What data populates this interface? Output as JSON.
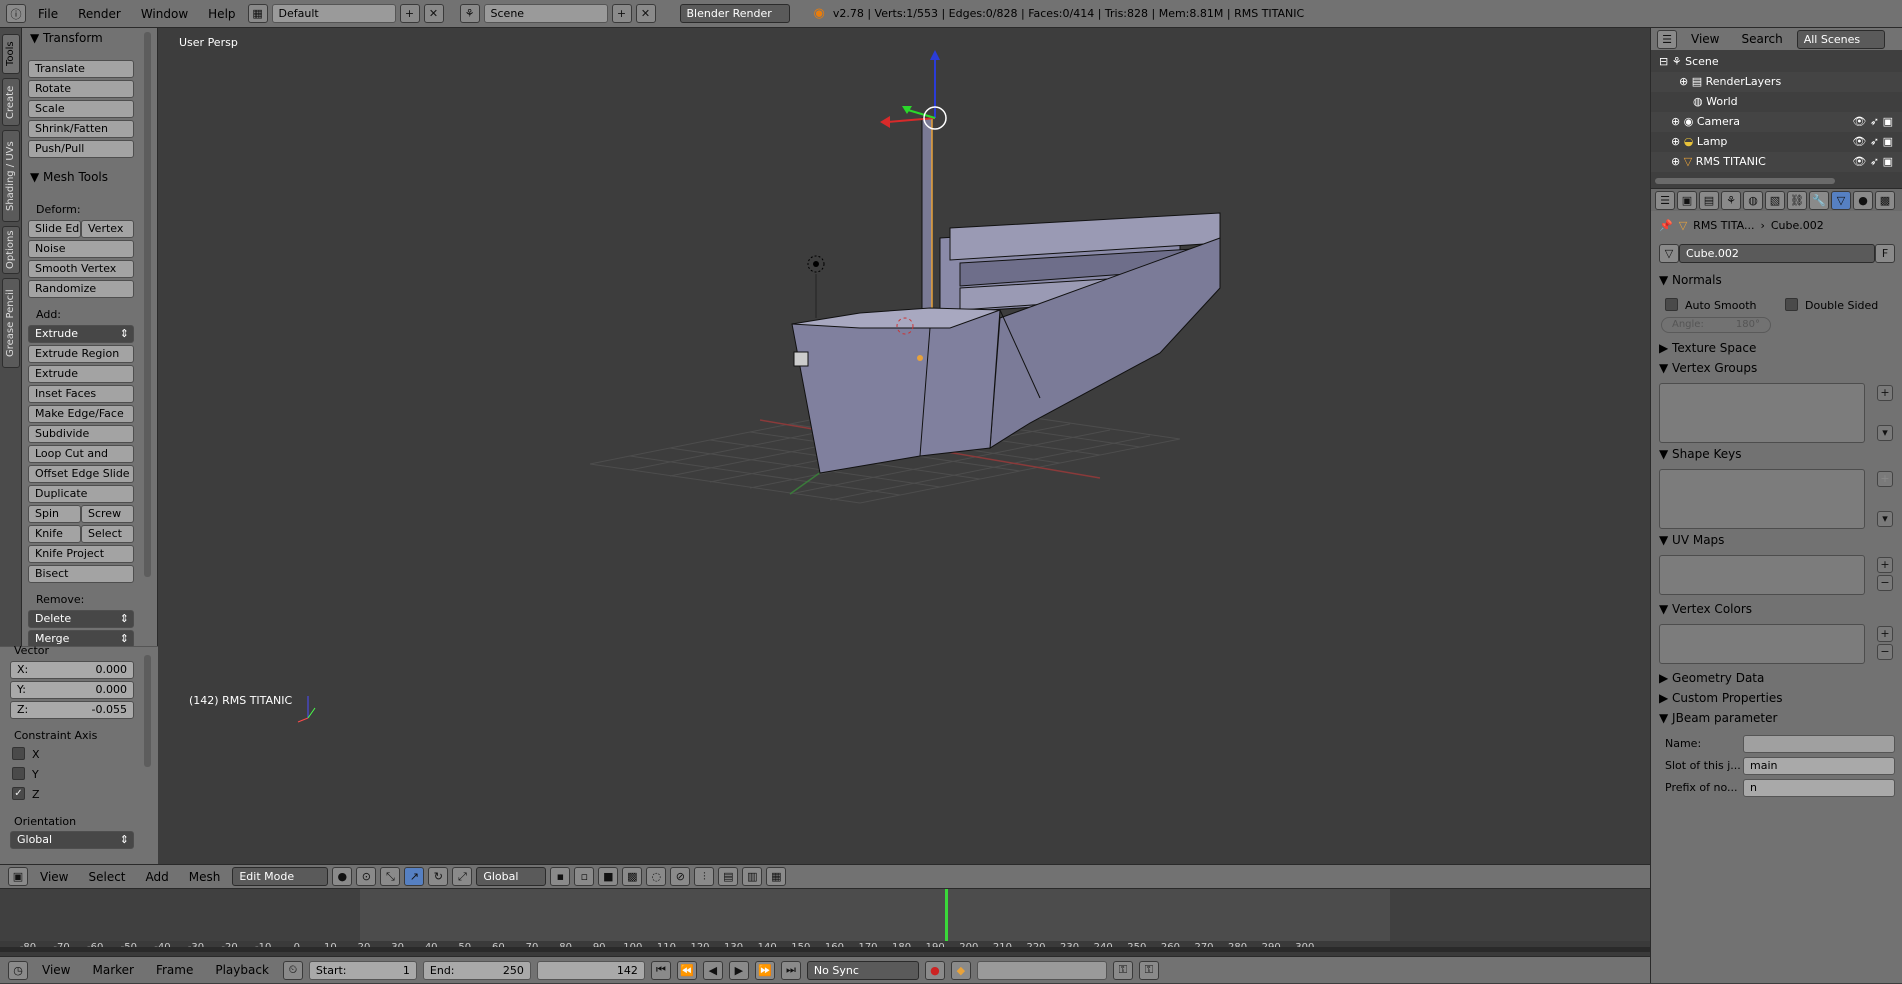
{
  "topbar": {
    "menus": [
      "File",
      "Render",
      "Window",
      "Help"
    ],
    "screen_layout": "Default",
    "scene": "Scene",
    "render_engine": "Blender Render",
    "stats": "v2.78 | Verts:1/553 | Edges:0/828 | Faces:0/414 | Tris:828 | Mem:8.81M | RMS TITANIC"
  },
  "tooltabs": [
    "Tools",
    "Create",
    "Shading / UVs",
    "Options",
    "Grease Pencil"
  ],
  "toolpanel": {
    "transform_title": "Transform",
    "transform_buttons": [
      "Translate",
      "Rotate",
      "Scale",
      "Shrink/Fatten",
      "Push/Pull"
    ],
    "meshtools_title": "Mesh Tools",
    "deform_label": "Deform:",
    "slide_edge": "Slide Ed",
    "vertex": "Vertex",
    "noise": "Noise",
    "smooth_vertex": "Smooth Vertex",
    "randomize": "Randomize",
    "add_label": "Add:",
    "extrude": "Extrude",
    "extrude_region": "Extrude Region",
    "extrude_individual": "Extrude Individual",
    "inset_faces": "Inset Faces",
    "make_edge_face": "Make Edge/Face",
    "subdivide": "Subdivide",
    "loop_cut": "Loop Cut and Slide",
    "offset_edge": "Offset Edge Slide",
    "duplicate": "Duplicate",
    "spin": "Spin",
    "screw": "Screw",
    "knife": "Knife",
    "select": "Select",
    "knife_project": "Knife Project",
    "bisect": "Bisect",
    "remove_label": "Remove:",
    "delete": "Delete",
    "merge": "Merge"
  },
  "operator": {
    "vector_label": "Vector",
    "x_label": "X:",
    "x_value": "0.000",
    "y_label": "Y:",
    "y_value": "0.000",
    "z_label": "Z:",
    "z_value": "-0.055",
    "constraint_label": "Constraint Axis",
    "axis_x": "X",
    "axis_y": "Y",
    "axis_z": "Z",
    "orientation_label": "Orientation",
    "orientation_value": "Global"
  },
  "viewport": {
    "view_name": "User Persp",
    "object_info": "(142) RMS TITANIC"
  },
  "header3d": {
    "menus": [
      "View",
      "Select",
      "Add",
      "Mesh"
    ],
    "mode": "Edit Mode",
    "orientation": "Global"
  },
  "timeline": {
    "ticks": [
      "-80",
      "-70",
      "-60",
      "-50",
      "-40",
      "-30",
      "-20",
      "-10",
      "0",
      "10",
      "20",
      "30",
      "40",
      "50",
      "60",
      "70",
      "80",
      "90",
      "100",
      "110",
      "120",
      "130",
      "140",
      "150",
      "160",
      "170",
      "180",
      "190",
      "200",
      "210",
      "220",
      "230",
      "240",
      "250",
      "260",
      "270",
      "280",
      "290",
      "300"
    ],
    "menus": [
      "View",
      "Marker",
      "Frame",
      "Playback"
    ],
    "start_label": "Start:",
    "start_value": "1",
    "end_label": "End:",
    "end_value": "250",
    "current_frame": "142",
    "sync": "No Sync"
  },
  "outliner": {
    "header_menus": [
      "View",
      "Search"
    ],
    "filter": "All Scenes",
    "items": [
      "Scene",
      "RenderLayers",
      "World",
      "Camera",
      "Lamp",
      "RMS TITANIC"
    ]
  },
  "properties": {
    "breadcrumb_object": "RMS TITA...",
    "breadcrumb_data": "Cube.002",
    "mesh_name": "Cube.002",
    "fake_user": "F",
    "normals_title": "Normals",
    "auto_smooth": "Auto Smooth",
    "double_sided": "Double Sided",
    "angle_label": "Angle:",
    "angle_value": "180°",
    "texture_space": "Texture Space",
    "vertex_groups": "Vertex Groups",
    "shape_keys": "Shape Keys",
    "uv_maps": "UV Maps",
    "vertex_colors": "Vertex Colors",
    "geometry_data": "Geometry Data",
    "custom_properties": "Custom Properties",
    "jbeam_title": "JBeam parameter",
    "name_label": "Name:",
    "name_value": "",
    "slot_label": "Slot of this j...",
    "slot_value": "main",
    "prefix_label": "Prefix of no...",
    "prefix_value": "n"
  }
}
